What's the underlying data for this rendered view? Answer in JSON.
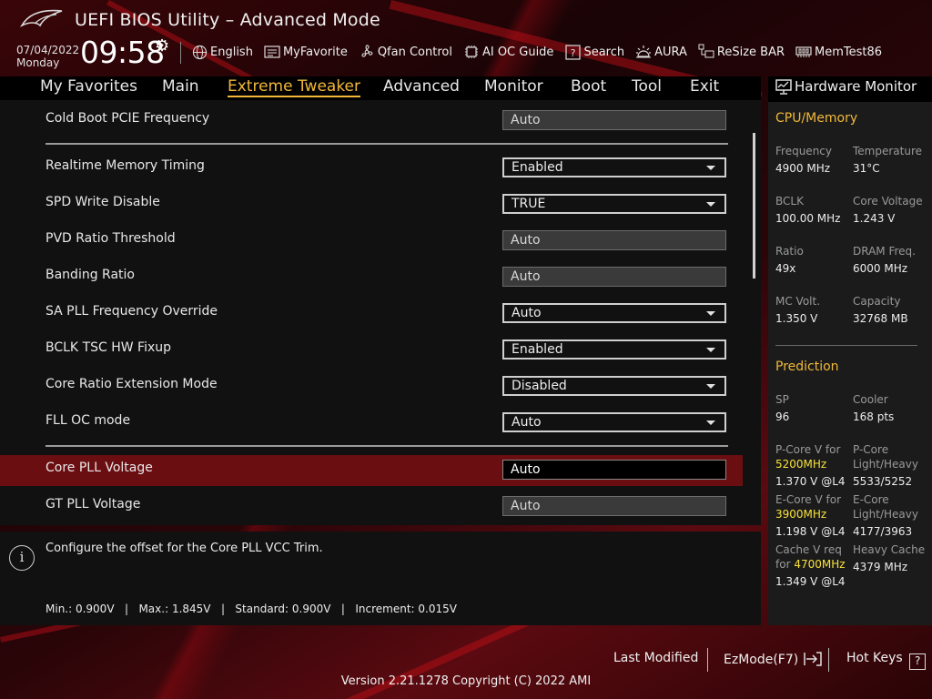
{
  "app": {
    "title": "UEFI BIOS Utility – Advanced Mode"
  },
  "status": {
    "date": "07/04/2022",
    "day": "Monday",
    "time": "09:58"
  },
  "toolbar": [
    {
      "label": "English",
      "icon": "globe-icon"
    },
    {
      "label": "MyFavorite",
      "icon": "favorite-icon"
    },
    {
      "label": "Qfan Control",
      "icon": "fan-icon"
    },
    {
      "label": "AI OC Guide",
      "icon": "chip-icon"
    },
    {
      "label": "Search",
      "icon": "search-icon"
    },
    {
      "label": "AURA",
      "icon": "aura-icon"
    },
    {
      "label": "ReSize BAR",
      "icon": "resize-bar-icon"
    },
    {
      "label": "MemTest86",
      "icon": "memory-icon"
    }
  ],
  "nav": {
    "tabs": [
      "My Favorites",
      "Main",
      "Extreme Tweaker",
      "Advanced",
      "Monitor",
      "Boot",
      "Tool",
      "Exit"
    ],
    "active": "Extreme Tweaker"
  },
  "settings": [
    {
      "label": "Cold Boot PCIE Frequency",
      "value": "Auto",
      "kind": "static"
    },
    {
      "label": "Realtime Memory Timing",
      "value": "Enabled",
      "kind": "dropdown"
    },
    {
      "label": "SPD Write Disable",
      "value": "TRUE",
      "kind": "dropdown"
    },
    {
      "label": "PVD Ratio Threshold",
      "value": "Auto",
      "kind": "static"
    },
    {
      "label": "Banding Ratio",
      "value": "Auto",
      "kind": "static"
    },
    {
      "label": "SA PLL Frequency Override",
      "value": "Auto",
      "kind": "dropdown"
    },
    {
      "label": "BCLK TSC HW Fixup",
      "value": "Enabled",
      "kind": "dropdown"
    },
    {
      "label": "Core Ratio Extension Mode",
      "value": "Disabled",
      "kind": "dropdown"
    },
    {
      "label": "FLL OC mode",
      "value": "Auto",
      "kind": "dropdown"
    },
    {
      "label": "Core PLL Voltage",
      "value": "Auto",
      "kind": "editing",
      "selected": true
    },
    {
      "label": "GT PLL Voltage",
      "value": "Auto",
      "kind": "static"
    }
  ],
  "help": {
    "text": "Configure the offset for the Core PLL VCC Trim.",
    "range": "Min.: 0.900V   |   Max.: 1.845V   |   Standard: 0.900V   |   Increment: 0.015V"
  },
  "hw_monitor": {
    "title": "Hardware Monitor",
    "cpu_section": "CPU/Memory",
    "cpu": [
      {
        "label": "Frequency",
        "value": "4900 MHz"
      },
      {
        "label": "Temperature",
        "value": "31°C"
      },
      {
        "label": "BCLK",
        "value": "100.00 MHz"
      },
      {
        "label": "Core Voltage",
        "value": "1.243 V"
      },
      {
        "label": "Ratio",
        "value": "49x"
      },
      {
        "label": "DRAM Freq.",
        "value": "6000 MHz"
      },
      {
        "label": "MC Volt.",
        "value": "1.350 V"
      },
      {
        "label": "Capacity",
        "value": "32768 MB"
      }
    ],
    "pred_section": "Prediction",
    "prediction": {
      "sp_label": "SP",
      "sp_value": "96",
      "cooler_label": "Cooler",
      "cooler_value": "168 pts",
      "pcore_v_label": "P-Core V for",
      "pcore_v_freq": "5200MHz",
      "pcore_v_value": "1.370 V @L4",
      "pcore_lh_label1": "P-Core",
      "pcore_lh_label2": "Light/Heavy",
      "pcore_lh_value": "5533/5252",
      "ecore_v_label": "E-Core V for",
      "ecore_v_freq": "3900MHz",
      "ecore_v_value": "1.198 V @L4",
      "ecore_lh_label1": "E-Core",
      "ecore_lh_label2": "Light/Heavy",
      "ecore_lh_value": "4177/3963",
      "cache_v_label1": "Cache V req",
      "cache_v_label2": "for",
      "cache_v_freq": "4700MHz",
      "cache_v_value": "1.349 V @L4",
      "heavy_cache_label": "Heavy Cache",
      "heavy_cache_value": "4379 MHz"
    }
  },
  "footer": {
    "last_modified": "Last Modified",
    "ezmode": "EzMode(F7)",
    "hot_keys": "Hot Keys",
    "hot_keys_symbol": "?",
    "version": "Version 2.21.1278 Copyright (C) 2022 AMI"
  },
  "colors": {
    "accent": "#f2b83a",
    "highlight": "#f7e23a",
    "selected_row": "#6b0e12"
  }
}
